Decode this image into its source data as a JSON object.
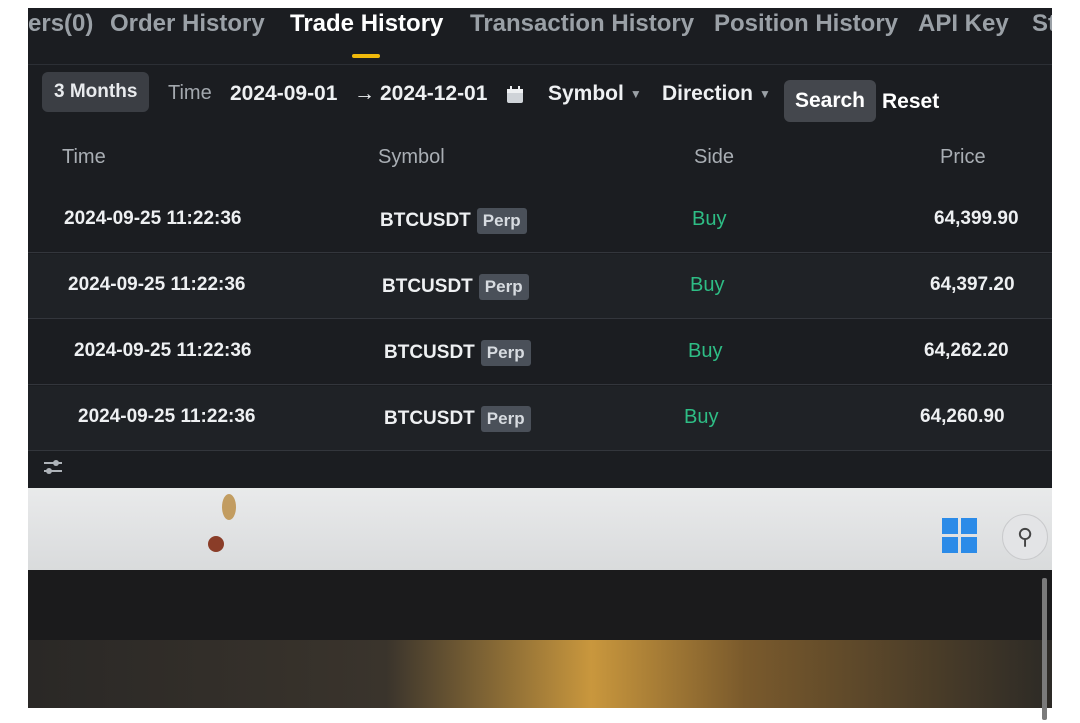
{
  "tabs": [
    {
      "label": "ers(0)"
    },
    {
      "label": "Order History"
    },
    {
      "label": "Trade History"
    },
    {
      "label": "Transaction History"
    },
    {
      "label": "Position History"
    },
    {
      "label": "API Key"
    },
    {
      "label": "St"
    }
  ],
  "active_tab": "Trade History",
  "filters": {
    "range_chip": "3 Months",
    "time_label": "Time",
    "date_from": "2024-09-01",
    "arrow": "→",
    "date_to": "2024-12-01",
    "symbol_label": "Symbol",
    "direction_label": "Direction",
    "search_label": "Search",
    "reset_label": "Reset"
  },
  "table": {
    "columns": [
      "Time",
      "Symbol",
      "Side",
      "Price"
    ],
    "rows": [
      {
        "time": "2024-09-25 11:22:36",
        "symbol": "BTCUSDT",
        "badge": "Perp",
        "side": "Buy",
        "price": "64,399.90"
      },
      {
        "time": "2024-09-25 11:22:36",
        "symbol": "BTCUSDT",
        "badge": "Perp",
        "side": "Buy",
        "price": "64,397.20"
      },
      {
        "time": "2024-09-25 11:22:36",
        "symbol": "BTCUSDT",
        "badge": "Perp",
        "side": "Buy",
        "price": "64,262.20"
      },
      {
        "time": "2024-09-25 11:22:36",
        "symbol": "BTCUSDT",
        "badge": "Perp",
        "side": "Buy",
        "price": "64,260.90"
      }
    ]
  },
  "colors": {
    "background": "#1b1d21",
    "buy": "#2ebd85",
    "accent": "#f0b90b",
    "taskbar": "#e2e3e4"
  },
  "icons": {
    "calendar": "calendar-icon",
    "settings": "sliders-icon",
    "windows": "windows-logo-icon",
    "search": "search-icon"
  }
}
